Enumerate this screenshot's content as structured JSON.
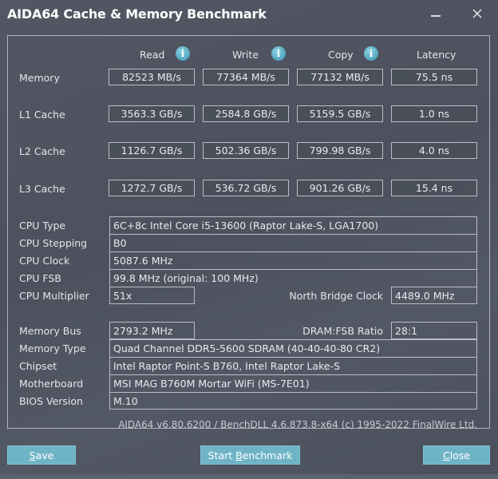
{
  "window": {
    "title": "AIDA64 Cache & Memory Benchmark",
    "minimize_icon": "minimize-icon",
    "close_icon": "close-icon"
  },
  "columns": {
    "read": "Read",
    "write": "Write",
    "copy": "Copy",
    "latency": "Latency",
    "info_icon": "info-icon",
    "info_glyph": "i"
  },
  "benchmark_rows": [
    {
      "label": "Memory",
      "read": "82523 MB/s",
      "write": "77364 MB/s",
      "copy": "77132 MB/s",
      "latency": "75.5 ns"
    },
    {
      "label": "L1 Cache",
      "read": "3563.3 GB/s",
      "write": "2584.8 GB/s",
      "copy": "5159.5 GB/s",
      "latency": "1.0 ns"
    },
    {
      "label": "L2 Cache",
      "read": "1126.7 GB/s",
      "write": "502.36 GB/s",
      "copy": "799.98 GB/s",
      "latency": "4.0 ns"
    },
    {
      "label": "L3 Cache",
      "read": "1272.7 GB/s",
      "write": "536.72 GB/s",
      "copy": "901.26 GB/s",
      "latency": "15.4 ns"
    }
  ],
  "cpu_info": {
    "cpu_type_label": "CPU Type",
    "cpu_type": "6C+8c Intel Core i5-13600  (Raptor Lake-S, LGA1700)",
    "cpu_stepping_label": "CPU Stepping",
    "cpu_stepping": "B0",
    "cpu_clock_label": "CPU Clock",
    "cpu_clock": "5087.6 MHz",
    "cpu_fsb_label": "CPU FSB",
    "cpu_fsb": "99.8 MHz  (original: 100 MHz)",
    "cpu_multiplier_label": "CPU Multiplier",
    "cpu_multiplier": "51x",
    "nb_clock_label": "North Bridge Clock",
    "nb_clock": "4489.0 MHz"
  },
  "memory_info": {
    "memory_bus_label": "Memory Bus",
    "memory_bus": "2793.2 MHz",
    "dram_fsb_label": "DRAM:FSB Ratio",
    "dram_fsb": "28:1",
    "memory_type_label": "Memory Type",
    "memory_type": "Quad Channel DDR5-5600 SDRAM  (40-40-40-80 CR2)",
    "chipset_label": "Chipset",
    "chipset": "Intel Raptor Point-S B760, Intel Raptor Lake-S",
    "motherboard_label": "Motherboard",
    "motherboard": "MSI MAG B760M Mortar WiFi (MS-7E01)",
    "bios_label": "BIOS Version",
    "bios": "M.10"
  },
  "footer": "AIDA64 v6.80.6200 / BenchDLL 4.6.873.8-x64  (c) 1995-2022 FinalWire Ltd.",
  "buttons": {
    "save_access": "S",
    "save_rest": "ave",
    "start_prefix": "Start ",
    "start_access": "B",
    "start_rest": "enchmark",
    "close_access": "C",
    "close_rest": "lose"
  },
  "colors": {
    "button_bg": "#6fb4c6",
    "info_icon": "#5aaec6",
    "window_bg": "#4f5460"
  }
}
